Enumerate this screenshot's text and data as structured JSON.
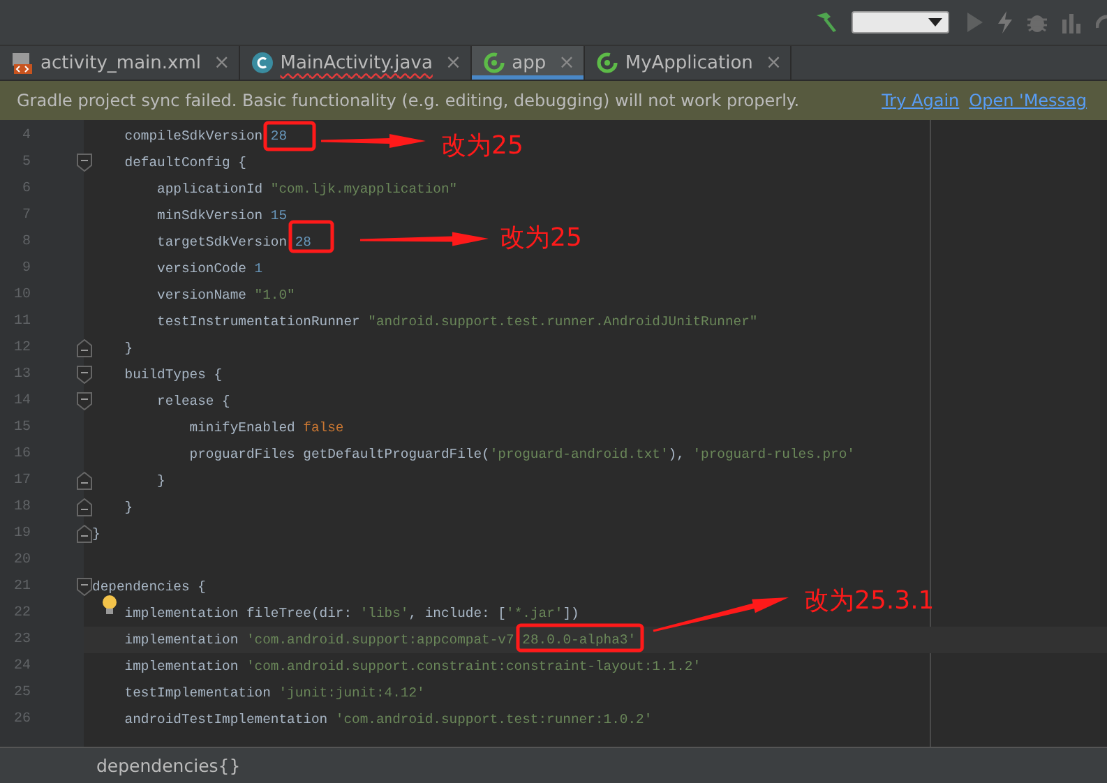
{
  "tabs": [
    {
      "label": "activity_main.xml",
      "kind": "xml",
      "close": "×",
      "selected": false,
      "error": false
    },
    {
      "label": "MainActivity.java",
      "kind": "class",
      "close": "×",
      "selected": false,
      "error": true
    },
    {
      "label": "app",
      "kind": "gradle",
      "close": "×",
      "selected": true,
      "error": false
    },
    {
      "label": "MyApplication",
      "kind": "gradle",
      "close": "×",
      "selected": false,
      "error": false
    }
  ],
  "banner": {
    "message": "Gradle project sync failed. Basic functionality (e.g. editing, debugging) will not work properly.",
    "links": [
      "Try Again",
      "Open 'Messag"
    ]
  },
  "editor": {
    "lines": [
      {
        "n": "4",
        "kind": "plain",
        "current": false,
        "bulb": false,
        "tokens": [
          {
            "t": "    compileSdkVersion ",
            "kind": "plain"
          },
          {
            "t": "28",
            "kind": "num"
          }
        ]
      },
      {
        "n": "5",
        "kind": "fold-start",
        "current": false,
        "bulb": false,
        "tokens": [
          {
            "t": "    defaultConfig {",
            "kind": "plain"
          }
        ]
      },
      {
        "n": "6",
        "kind": "plain",
        "current": false,
        "bulb": false,
        "tokens": [
          {
            "t": "        applicationId ",
            "kind": "plain"
          },
          {
            "t": "\"com.ljk.myapplication\"",
            "kind": "str"
          }
        ]
      },
      {
        "n": "7",
        "kind": "plain",
        "current": false,
        "bulb": false,
        "tokens": [
          {
            "t": "        minSdkVersion ",
            "kind": "plain"
          },
          {
            "t": "15",
            "kind": "num"
          }
        ]
      },
      {
        "n": "8",
        "kind": "plain",
        "current": false,
        "bulb": false,
        "tokens": [
          {
            "t": "        targetSdkVersion ",
            "kind": "plain"
          },
          {
            "t": "28",
            "kind": "num"
          }
        ]
      },
      {
        "n": "9",
        "kind": "plain",
        "current": false,
        "bulb": false,
        "tokens": [
          {
            "t": "        versionCode ",
            "kind": "plain"
          },
          {
            "t": "1",
            "kind": "num"
          }
        ]
      },
      {
        "n": "10",
        "kind": "plain",
        "current": false,
        "bulb": false,
        "tokens": [
          {
            "t": "        versionName ",
            "kind": "plain"
          },
          {
            "t": "\"1.0\"",
            "kind": "str"
          }
        ]
      },
      {
        "n": "11",
        "kind": "plain",
        "current": false,
        "bulb": false,
        "tokens": [
          {
            "t": "        testInstrumentationRunner ",
            "kind": "plain"
          },
          {
            "t": "\"android.support.test.runner.AndroidJUnitRunner\"",
            "kind": "str"
          }
        ]
      },
      {
        "n": "12",
        "kind": "fold-end",
        "current": false,
        "bulb": false,
        "tokens": [
          {
            "t": "    }",
            "kind": "plain"
          }
        ]
      },
      {
        "n": "13",
        "kind": "fold-start",
        "current": false,
        "bulb": false,
        "tokens": [
          {
            "t": "    buildTypes {",
            "kind": "plain"
          }
        ]
      },
      {
        "n": "14",
        "kind": "fold-start",
        "current": false,
        "bulb": false,
        "tokens": [
          {
            "t": "        release {",
            "kind": "plain"
          }
        ]
      },
      {
        "n": "15",
        "kind": "plain",
        "current": false,
        "bulb": false,
        "tokens": [
          {
            "t": "            minifyEnabled ",
            "kind": "plain"
          },
          {
            "t": "false",
            "kind": "kw"
          }
        ]
      },
      {
        "n": "16",
        "kind": "plain",
        "current": false,
        "bulb": false,
        "tokens": [
          {
            "t": "            proguardFiles getDefaultProguardFile(",
            "kind": "plain"
          },
          {
            "t": "'proguard-android.txt'",
            "kind": "str"
          },
          {
            "t": "), ",
            "kind": "plain"
          },
          {
            "t": "'proguard-rules.pro'",
            "kind": "str"
          }
        ]
      },
      {
        "n": "17",
        "kind": "fold-end",
        "current": false,
        "bulb": false,
        "tokens": [
          {
            "t": "        }",
            "kind": "plain"
          }
        ]
      },
      {
        "n": "18",
        "kind": "fold-end",
        "current": false,
        "bulb": false,
        "tokens": [
          {
            "t": "    }",
            "kind": "plain"
          }
        ]
      },
      {
        "n": "19",
        "kind": "fold-end",
        "current": false,
        "bulb": false,
        "tokens": [
          {
            "t": "}",
            "kind": "plain"
          }
        ]
      },
      {
        "n": "20",
        "kind": "plain",
        "current": false,
        "bulb": false
      },
      {
        "n": "21",
        "kind": "fold-start",
        "current": false,
        "bulb": false,
        "tokens": [
          {
            "t": "dependencies {",
            "kind": "plain"
          }
        ]
      },
      {
        "n": "22",
        "kind": "plain",
        "current": false,
        "bulb": true,
        "tokens": [
          {
            "t": "    implementation fileTree(dir: ",
            "kind": "plain"
          },
          {
            "t": "'libs'",
            "kind": "str"
          },
          {
            "t": ", include: [",
            "kind": "plain"
          },
          {
            "t": "'*.jar'",
            "kind": "str"
          },
          {
            "t": "])",
            "kind": "plain"
          }
        ]
      },
      {
        "n": "23",
        "kind": "plain",
        "current": true,
        "bulb": false,
        "tokens": [
          {
            "t": "    implementation ",
            "kind": "plain"
          },
          {
            "t": "'com.android.support:appcompat-v7:28.0.0-alpha3'",
            "kind": "str"
          }
        ]
      },
      {
        "n": "24",
        "kind": "plain",
        "current": false,
        "bulb": false,
        "tokens": [
          {
            "t": "    implementation ",
            "kind": "plain"
          },
          {
            "t": "'com.android.support.constraint:constraint-layout:1.1.2'",
            "kind": "str"
          }
        ]
      },
      {
        "n": "25",
        "kind": "plain",
        "current": false,
        "bulb": false,
        "tokens": [
          {
            "t": "    testImplementation ",
            "kind": "plain"
          },
          {
            "t": "'junit:junit:4.12'",
            "kind": "str"
          }
        ]
      },
      {
        "n": "26",
        "kind": "plain",
        "current": false,
        "bulb": false,
        "tokens": [
          {
            "t": "    androidTestImplementation ",
            "kind": "plain"
          },
          {
            "t": "'com.android.support.test:runner:1.0.2'",
            "kind": "str"
          }
        ]
      }
    ]
  },
  "annotations": [
    {
      "label": "改为25"
    },
    {
      "label": "改为25"
    },
    {
      "label": "改为25.3.1"
    }
  ],
  "breadcrumb": "dependencies{}"
}
